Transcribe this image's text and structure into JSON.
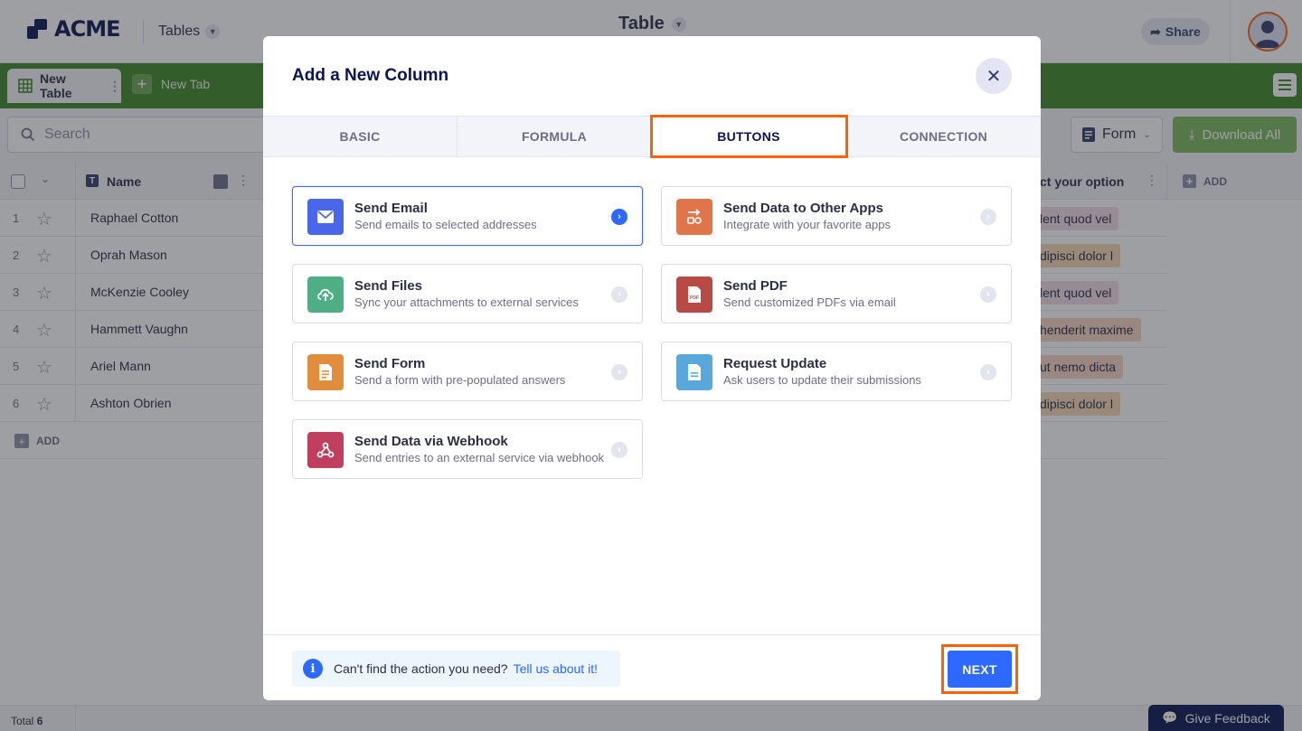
{
  "app": {
    "logo_text": "ACME",
    "tables_dropdown": "Tables",
    "title": "Table",
    "share_label": "Share"
  },
  "tabs": {
    "active_tab": "New Table",
    "new_tab": "New Tab"
  },
  "toolbar": {
    "search_placeholder": "Search",
    "form_dropdown": "Form",
    "download_label": "Download All"
  },
  "grid": {
    "name_header": "Name",
    "right_header": "ct your option",
    "add_column": "ADD",
    "add_row": "ADD",
    "rows": [
      {
        "num": "1",
        "name": "Raphael Cotton",
        "option": "lent quod vel",
        "color": "#f3dde7"
      },
      {
        "num": "2",
        "name": "Oprah Mason",
        "option": "dipisci dolor l",
        "color": "#f4d7b1"
      },
      {
        "num": "3",
        "name": "McKenzie Cooley",
        "option": "lent quod vel",
        "color": "#f3dde7"
      },
      {
        "num": "4",
        "name": "Hammett Vaughn",
        "option": "henderit maxime",
        "color": "#f7d3c4"
      },
      {
        "num": "5",
        "name": "Ariel Mann",
        "option": "ut nemo dicta",
        "color": "#f7d3c4"
      },
      {
        "num": "6",
        "name": "Ashton Obrien",
        "option": "dipisci dolor l",
        "color": "#f4d7b1"
      }
    ]
  },
  "footer": {
    "total_label": "Total",
    "total_value": "6",
    "feedback_label": "Give Feedback"
  },
  "modal": {
    "title": "Add a New Column",
    "tabs": [
      "BASIC",
      "FORMULA",
      "BUTTONS",
      "CONNECTION"
    ],
    "active_tab": "BUTTONS",
    "cards": [
      {
        "title": "Send Email",
        "desc": "Send emails to selected addresses",
        "icon": "mail-icon",
        "color": "#4a67e9",
        "selected": true
      },
      {
        "title": "Send Data to Other Apps",
        "desc": "Integrate with your favorite apps",
        "icon": "apps-icon",
        "color": "#e0744b",
        "selected": false
      },
      {
        "title": "Send Files",
        "desc": "Sync your attachments to external services",
        "icon": "cloud-upload-icon",
        "color": "#4fae85",
        "selected": false
      },
      {
        "title": "Send PDF",
        "desc": "Send customized PDFs via email",
        "icon": "pdf-icon",
        "color": "#b84a45",
        "selected": false
      },
      {
        "title": "Send Form",
        "desc": "Send a form with pre-populated answers",
        "icon": "form-icon",
        "color": "#e08d3e",
        "selected": false
      },
      {
        "title": "Request Update",
        "desc": "Ask users to update their submissions",
        "icon": "document-icon",
        "color": "#5aa7dc",
        "selected": false
      },
      {
        "title": "Send Data via Webhook",
        "desc": "Send entries to an external service via webhook",
        "icon": "webhook-icon",
        "color": "#c03f5e",
        "selected": false
      }
    ],
    "footer_text": "Can't find the action you need?",
    "footer_link": "Tell us about it!",
    "next_label": "NEXT"
  }
}
